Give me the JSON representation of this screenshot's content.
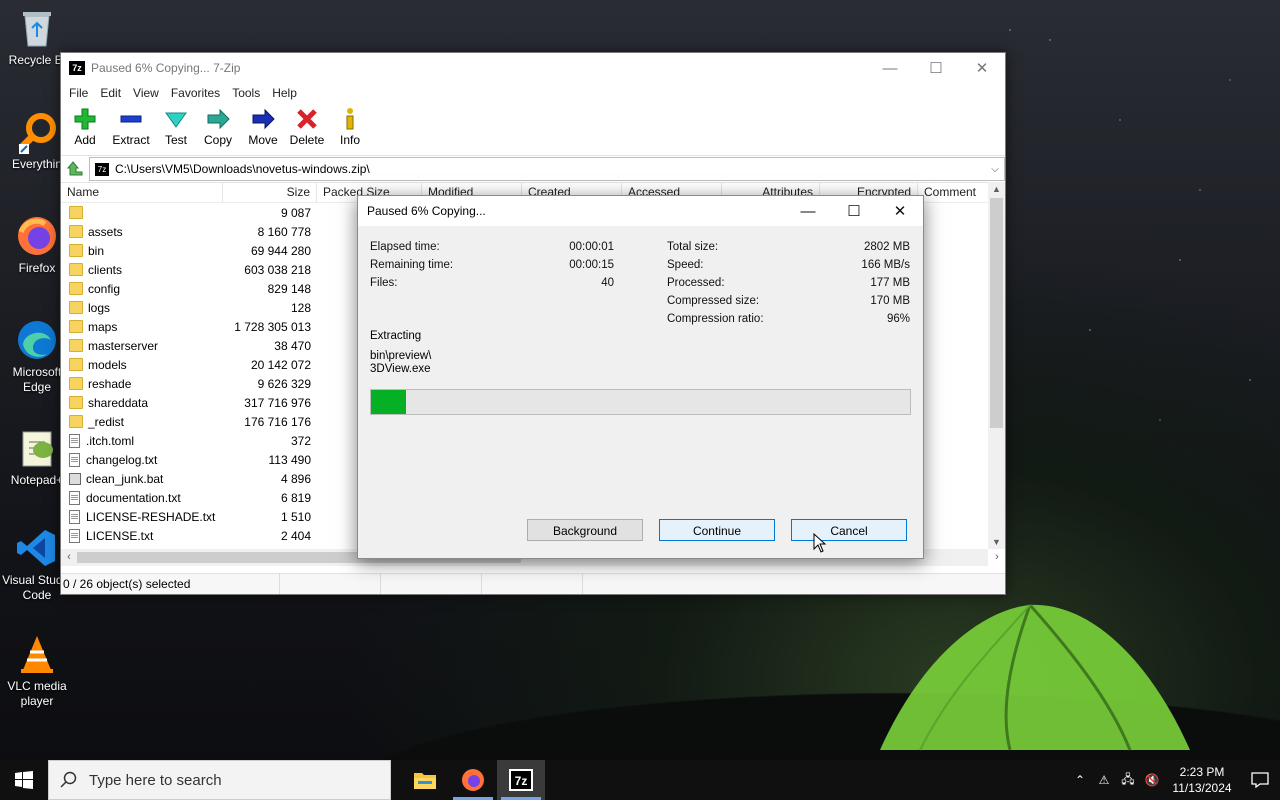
{
  "desktop": {
    "icons": [
      {
        "label": "Recycle Bi",
        "icon": "recycle-bin-icon"
      },
      {
        "label": "Everythin",
        "icon": "everything-search-icon"
      },
      {
        "label": "Firefox",
        "icon": "firefox-icon"
      },
      {
        "label": "Microsoft Edge",
        "icon": "edge-icon"
      },
      {
        "label": "Notepad+",
        "icon": "notepad-plus-plus-icon"
      },
      {
        "label": "Visual Studio Code",
        "icon": "vscode-icon"
      },
      {
        "label": "VLC media player",
        "icon": "vlc-icon"
      }
    ]
  },
  "window": {
    "title": "Paused 6% Copying... 7-Zip",
    "app_icon_text": "7z",
    "controls": {
      "minimize": "—",
      "maximize": "☐",
      "close": "✕"
    },
    "menu": [
      "File",
      "Edit",
      "View",
      "Favorites",
      "Tools",
      "Help"
    ],
    "toolbar": [
      {
        "label": "Add",
        "icon": "add-plus-icon"
      },
      {
        "label": "Extract",
        "icon": "extract-minus-icon"
      },
      {
        "label": "Test",
        "icon": "test-check-icon"
      },
      {
        "label": "Copy",
        "icon": "copy-arrow-icon"
      },
      {
        "label": "Move",
        "icon": "move-arrow-icon"
      },
      {
        "label": "Delete",
        "icon": "delete-x-icon"
      },
      {
        "label": "Info",
        "icon": "info-icon"
      }
    ],
    "address": "C:\\Users\\VM5\\Downloads\\novetus-windows.zip\\",
    "columns": [
      "Name",
      "Size",
      "Packed Size",
      "Modified",
      "Created",
      "Accessed",
      "Attributes",
      "Encrypted",
      "Comment"
    ],
    "rows": [
      {
        "name": "",
        "size": "9 087",
        "type": "folder"
      },
      {
        "name": "assets",
        "size": "8 160 778",
        "type": "folder"
      },
      {
        "name": "bin",
        "size": "69 944 280",
        "type": "folder"
      },
      {
        "name": "clients",
        "size": "603 038 218",
        "type": "folder"
      },
      {
        "name": "config",
        "size": "829 148",
        "type": "folder"
      },
      {
        "name": "logs",
        "size": "128",
        "type": "folder"
      },
      {
        "name": "maps",
        "size": "1 728 305 013",
        "type": "folder"
      },
      {
        "name": "masterserver",
        "size": "38 470",
        "type": "folder"
      },
      {
        "name": "models",
        "size": "20 142 072",
        "type": "folder"
      },
      {
        "name": "reshade",
        "size": "9 626 329",
        "type": "folder"
      },
      {
        "name": "shareddata",
        "size": "317 716 976",
        "type": "folder"
      },
      {
        "name": "_redist",
        "size": "176 716 176",
        "type": "folder"
      },
      {
        "name": ".itch.toml",
        "size": "372",
        "type": "file"
      },
      {
        "name": "changelog.txt",
        "size": "113 490",
        "type": "file"
      },
      {
        "name": "clean_junk.bat",
        "size": "4 896",
        "type": "bat"
      },
      {
        "name": "documentation.txt",
        "size": "6 819",
        "type": "file"
      },
      {
        "name": "LICENSE-RESHADE.txt",
        "size": "1 510",
        "type": "file"
      },
      {
        "name": "LICENSE.txt",
        "size": "2 404",
        "type": "file"
      }
    ],
    "status": "0 / 26 object(s) selected"
  },
  "dialog": {
    "title": "Paused 6% Copying...",
    "controls": {
      "minimize": "—",
      "maximize": "☐",
      "close": "✕"
    },
    "left_stats": [
      {
        "label": "Elapsed time:",
        "value": "00:00:01"
      },
      {
        "label": "Remaining time:",
        "value": "00:00:15"
      },
      {
        "label": "Files:",
        "value": "40"
      }
    ],
    "right_stats": [
      {
        "label": "Total size:",
        "value": "2802 MB"
      },
      {
        "label": "Speed:",
        "value": "166 MB/s"
      },
      {
        "label": "Processed:",
        "value": "177 MB"
      },
      {
        "label": "Compressed size:",
        "value": "170 MB"
      },
      {
        "label": "Compression ratio:",
        "value": "96%"
      }
    ],
    "action": "Extracting",
    "path_line1": "bin\\preview\\",
    "path_line2": "3DView.exe",
    "progress_percent": 6.5,
    "progress_color": "#06b025",
    "buttons": {
      "background": "Background",
      "continue": "Continue",
      "cancel": "Cancel"
    }
  },
  "taskbar": {
    "search_placeholder": "Type here to search",
    "apps": [
      {
        "name": "file-explorer-icon"
      },
      {
        "name": "firefox-icon"
      },
      {
        "name": "7zip-icon"
      }
    ],
    "time": "2:23 PM",
    "date": "11/13/2024"
  }
}
